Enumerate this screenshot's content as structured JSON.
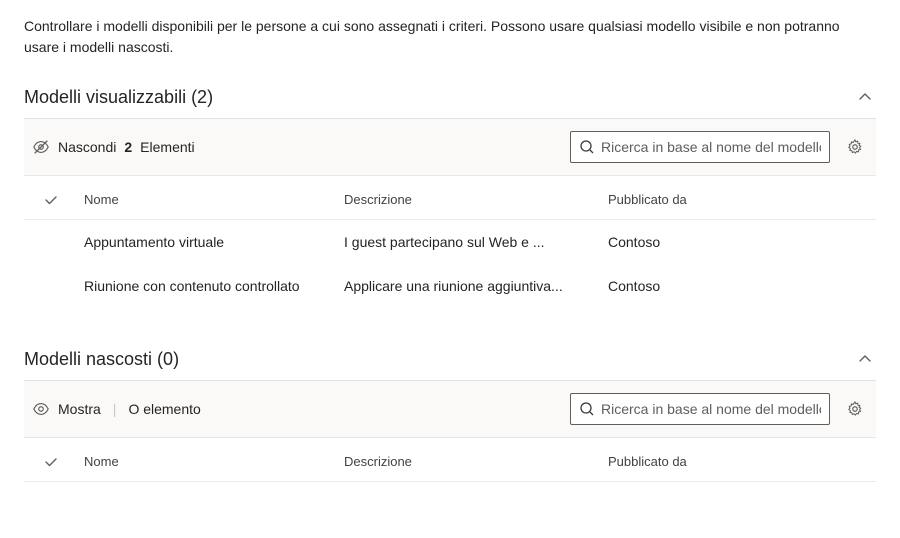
{
  "description": "Controllare i modelli disponibili per le persone a cui sono assegnati i criteri. Possono usare qualsiasi modello visibile e non potranno usare i modelli nascosti.",
  "viewable": {
    "title": "Modelli visualizzabili (2)",
    "action_label": "Nascondi",
    "count": "2",
    "count_label": "Elementi",
    "search_placeholder": "Ricerca in base al nome del modello",
    "columns": {
      "name": "Nome",
      "desc": "Descrizione",
      "pub": "Pubblicato da"
    },
    "rows": [
      {
        "name": "Appuntamento virtuale",
        "desc": "I guest partecipano sul Web e ...",
        "pub": "Contoso"
      },
      {
        "name": "Riunione con contenuto controllato",
        "desc": "Applicare una riunione aggiuntiva...",
        "pub": "Contoso"
      }
    ]
  },
  "hidden": {
    "title": "Modelli nascosti (0)",
    "action_label": "Mostra",
    "count_label": "O elemento",
    "search_placeholder": "Ricerca in base al nome del modello",
    "columns": {
      "name": "Nome",
      "desc": "Descrizione",
      "pub": "Pubblicato da"
    }
  }
}
